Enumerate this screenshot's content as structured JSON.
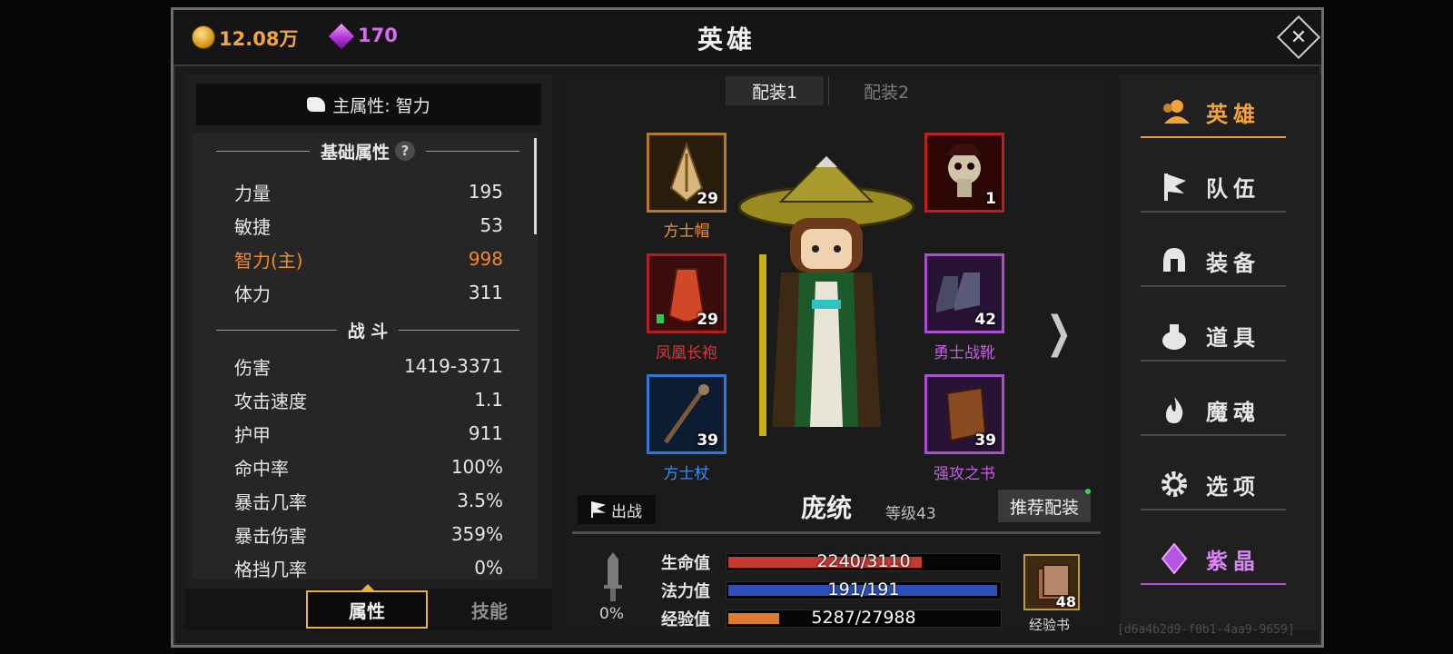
{
  "currency": {
    "gold": "12.08万",
    "gems": "170"
  },
  "title": "英雄",
  "left_panel": {
    "main_attribute": "主属性: 智力",
    "basic_header": "基础属性",
    "help": "?",
    "basic": [
      {
        "label": "力量",
        "value": "195"
      },
      {
        "label": "敏捷",
        "value": "53"
      },
      {
        "label": "智力(主)",
        "value": "998"
      },
      {
        "label": "体力",
        "value": "311"
      }
    ],
    "combat_header": "战 斗",
    "combat": [
      {
        "label": "伤害",
        "value": "1419-3371"
      },
      {
        "label": "攻击速度",
        "value": "1.1"
      },
      {
        "label": "护甲",
        "value": "911"
      },
      {
        "label": "命中率",
        "value": "100%"
      },
      {
        "label": "暴击几率",
        "value": "3.5%"
      },
      {
        "label": "暴击伤害",
        "value": "359%"
      },
      {
        "label": "格挡几率",
        "value": "0%"
      }
    ],
    "tabs": [
      "属性",
      "技能"
    ]
  },
  "loadout_tabs": [
    "配装1",
    "配装2"
  ],
  "equipment": [
    {
      "name": "方士帽",
      "level": "29",
      "rarity_color": "#f09030",
      "icon": "hat-icon"
    },
    {
      "name": "凤凰长袍",
      "level": "29",
      "rarity_color": "#e23434",
      "icon": "robe-icon"
    },
    {
      "name": "方士杖",
      "level": "39",
      "rarity_color": "#3c8ff0",
      "icon": "staff-icon"
    },
    {
      "name": "",
      "level": "1",
      "rarity_color": "#d22a2a",
      "icon": "skull-pet-icon"
    },
    {
      "name": "勇士战靴",
      "level": "42",
      "rarity_color": "#c95ae8",
      "icon": "boots-icon"
    },
    {
      "name": "强攻之书",
      "level": "39",
      "rarity_color": "#c95ae8",
      "icon": "book-icon"
    }
  ],
  "hero": {
    "name": "庞统",
    "level": "等级43",
    "deploy": "出战",
    "recommend": "推荐配装",
    "power_pct": "0%"
  },
  "bars": [
    {
      "label": "生命值",
      "text": "2240/3110",
      "fill": 0.72,
      "color": "#c73a2e"
    },
    {
      "label": "法力值",
      "text": "191/191",
      "fill": 1.0,
      "color": "#2f4fb8"
    },
    {
      "label": "经验值",
      "text": "5287/27988",
      "fill": 0.19,
      "color": "#e07a2e"
    }
  ],
  "exp_book": {
    "count": "48",
    "label": "经验书"
  },
  "right_menu": [
    {
      "label": "英雄",
      "icon": "users-icon"
    },
    {
      "label": "队伍",
      "icon": "flag-icon"
    },
    {
      "label": "装备",
      "icon": "helmet-icon"
    },
    {
      "label": "道具",
      "icon": "bag-icon"
    },
    {
      "label": "魔魂",
      "icon": "flame-icon"
    },
    {
      "label": "选项",
      "icon": "gear-icon"
    },
    {
      "label": "紫晶",
      "icon": "amethyst-icon"
    }
  ],
  "uuid": "[d6a4b2d9-f0b1-4aa9-9659]"
}
